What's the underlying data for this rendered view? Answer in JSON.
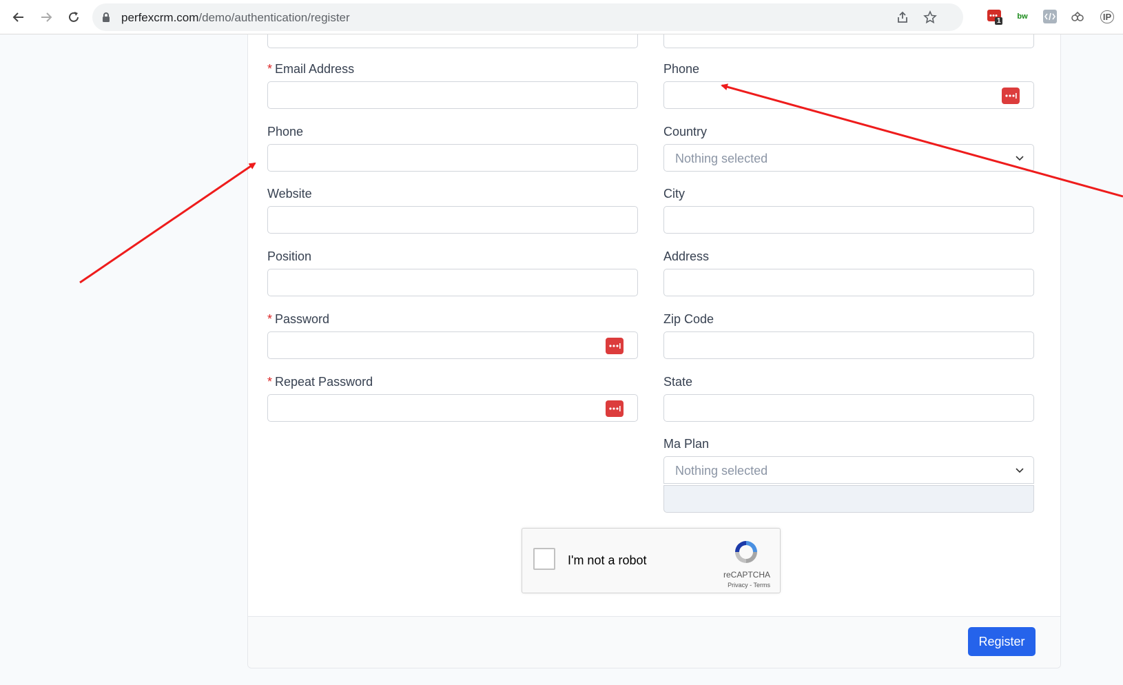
{
  "browser": {
    "url_host": "perfexcrm.com",
    "url_path": "/demo/authentication/register",
    "extensions": [
      "lastpass-extension-icon",
      "bw-extension-icon",
      "devtools-extension-icon",
      "link-extension-icon",
      "ip-extension-icon"
    ],
    "ext_badge": "1",
    "ext_bw": "bw",
    "ext_ip": "IP"
  },
  "form": {
    "left": {
      "email_label": "Email Address",
      "phone_label": "Phone",
      "website_label": "Website",
      "position_label": "Position",
      "password_label": "Password",
      "repeat_password_label": "Repeat Password"
    },
    "right": {
      "phone_label": "Phone",
      "country_label": "Country",
      "country_value": "Nothing selected",
      "city_label": "City",
      "address_label": "Address",
      "zip_label": "Zip Code",
      "state_label": "State",
      "plan_label": "Ma Plan",
      "plan_value": "Nothing selected"
    },
    "required_marker": "*"
  },
  "recaptcha": {
    "label": "I'm not a robot",
    "brand": "reCAPTCHA",
    "links": "Privacy - Terms"
  },
  "footer": {
    "register_label": "Register"
  },
  "colors": {
    "accent": "#2563eb",
    "required": "#dc2626",
    "annotation_arrow": "#ee1c1c"
  }
}
